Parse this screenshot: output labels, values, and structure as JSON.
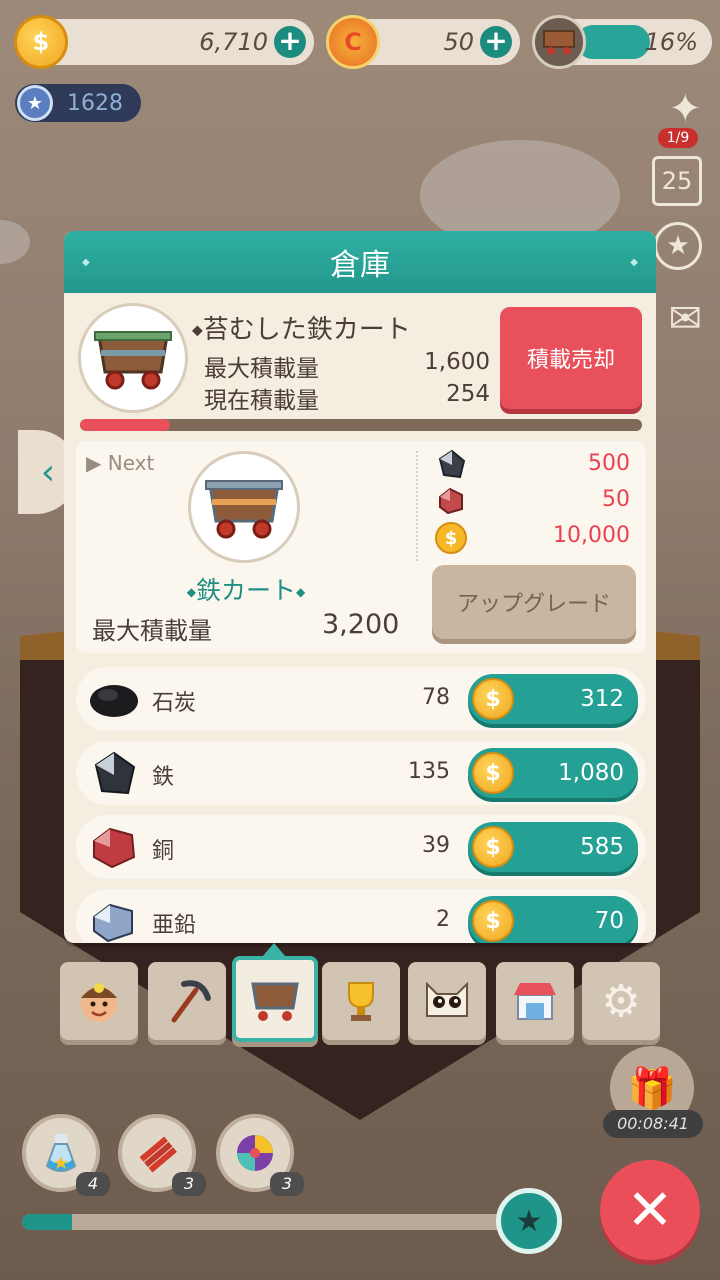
{
  "top_bar": {
    "coins": "6,710",
    "gems": "50",
    "cart_progress": "16%",
    "cart_progress_fraction": 0.16,
    "trophy_points": "1628"
  },
  "side": {
    "puzzle_count": "1/9",
    "calendar_day": "25"
  },
  "panel": {
    "title": "倉庫",
    "cart_name": "苔むした鉄カート",
    "max_load_label": "最大積載量",
    "max_load_value": "1,600",
    "current_load_label": "現在積載量",
    "current_load_value": "254",
    "current_load_fraction": 0.16,
    "sell_label": "積載売却",
    "next": {
      "label": "Next",
      "name": "鉄カート",
      "max_load_label": "最大積載量",
      "max_load_value": "3,200",
      "costs": [
        "500",
        "50",
        "10,000"
      ],
      "upgrade_label": "アップグレード"
    },
    "ores": [
      {
        "name": "石炭",
        "count": "78",
        "price": "312"
      },
      {
        "name": "鉄",
        "count": "135",
        "price": "1,080"
      },
      {
        "name": "銅",
        "count": "39",
        "price": "585"
      },
      {
        "name": "亜鉛",
        "count": "2",
        "price": "70"
      }
    ]
  },
  "items": [
    {
      "count": "4"
    },
    {
      "count": "3"
    },
    {
      "count": "3"
    }
  ],
  "timer": "00:08:41",
  "colors": {
    "teal": "#24a194",
    "red": "#e8505b",
    "panel": "#f4ede0"
  }
}
